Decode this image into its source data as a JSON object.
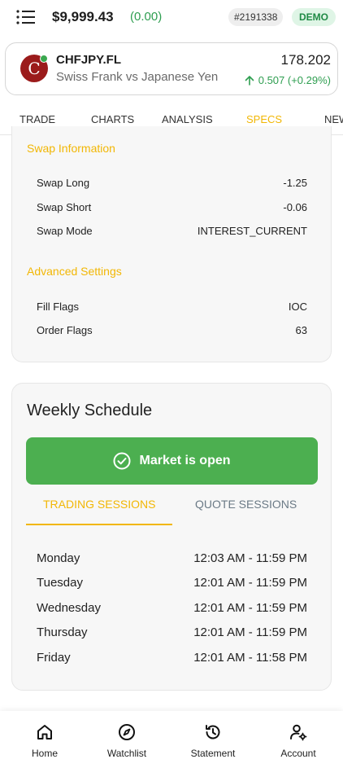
{
  "header": {
    "balance": "$9,999.43",
    "balance_change": "(0.00)",
    "account_id": "#2191338",
    "account_type": "DEMO"
  },
  "instrument": {
    "logo_letter": "C",
    "symbol": "CHFJPY.FL",
    "name": "Swiss Frank vs Japanese Yen",
    "price": "178.202",
    "change": "0.507 (+0.29%)"
  },
  "tabs": [
    {
      "label": "TRADE"
    },
    {
      "label": "CHARTS"
    },
    {
      "label": "ANALYSIS"
    },
    {
      "label": "SPECS"
    },
    {
      "label": "NEWS"
    }
  ],
  "specs": {
    "swap_title": "Swap Information",
    "swap_rows": [
      {
        "label": "Swap Long",
        "value": "-1.25"
      },
      {
        "label": "Swap Short",
        "value": "-0.06"
      },
      {
        "label": "Swap Mode",
        "value": "INTEREST_CURRENT"
      }
    ],
    "advanced_title": "Advanced Settings",
    "advanced_rows": [
      {
        "label": "Fill Flags",
        "value": "IOC"
      },
      {
        "label": "Order Flags",
        "value": "63"
      }
    ]
  },
  "schedule": {
    "title": "Weekly Schedule",
    "status": "Market is open",
    "tab_trading": "TRADING SESSIONS",
    "tab_quote": "QUOTE SESSIONS",
    "rows": [
      {
        "day": "Monday",
        "hours": "12:03 AM - 11:59 PM"
      },
      {
        "day": "Tuesday",
        "hours": "12:01 AM - 11:59 PM"
      },
      {
        "day": "Wednesday",
        "hours": "12:01 AM - 11:59 PM"
      },
      {
        "day": "Thursday",
        "hours": "12:01 AM - 11:59 PM"
      },
      {
        "day": "Friday",
        "hours": "12:01 AM - 11:58 PM"
      }
    ]
  },
  "bottom_nav": [
    {
      "label": "Home",
      "icon": "home-icon"
    },
    {
      "label": "Watchlist",
      "icon": "compass-icon"
    },
    {
      "label": "Statement",
      "icon": "history-icon"
    },
    {
      "label": "Account",
      "icon": "account-settings-icon"
    }
  ],
  "colors": {
    "accent": "#f2b705",
    "positive": "#2e9e50",
    "market_open": "#4caf50",
    "logo_bg": "#9b1b1b"
  }
}
